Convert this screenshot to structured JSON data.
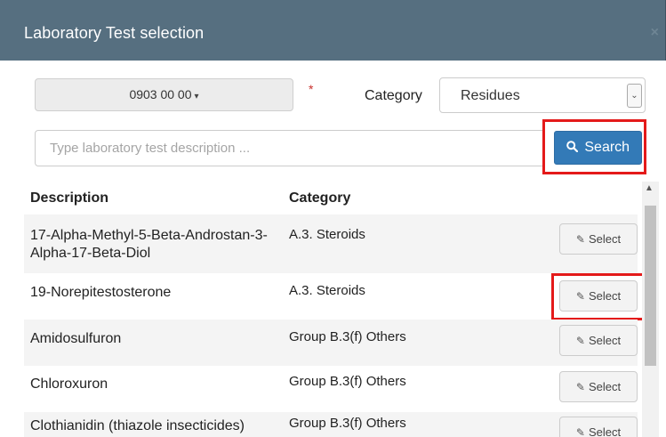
{
  "modal": {
    "title": "Laboratory Test selection",
    "close": "×"
  },
  "filters": {
    "dept_value": "0903 00 00",
    "caret": "▾",
    "required_mark": "*",
    "category_label": "Category",
    "category_value": "Residues",
    "select_arrow": "⌄"
  },
  "search": {
    "placeholder": "Type laboratory test description ...",
    "button_label": "Search",
    "button_icon": "search-icon"
  },
  "table": {
    "columns": [
      "Description",
      "Category"
    ],
    "rows": [
      {
        "description": "17-Alpha-Methyl-5-Beta-Androstan-3-Alpha-17-Beta-Diol",
        "category": "A.3. Steroids",
        "action": "Select"
      },
      {
        "description": "19-Norepitestosterone",
        "category": "A.3. Steroids",
        "action": "Select"
      },
      {
        "description": "Amidosulfuron",
        "category": "Group B.3(f) Others",
        "action": "Select"
      },
      {
        "description": "Chloroxuron",
        "category": "Group B.3(f) Others",
        "action": "Select"
      },
      {
        "description": "Clothianidin (thiazole insecticides)",
        "category": "Group B.3(f) Others",
        "action": "Select"
      }
    ]
  },
  "icons": {
    "edit": "✎",
    "search": "🔍",
    "scroll_up": "▲"
  },
  "colors": {
    "header_bg": "#566f80",
    "primary": "#337ab7",
    "highlight": "#e41a1a"
  }
}
